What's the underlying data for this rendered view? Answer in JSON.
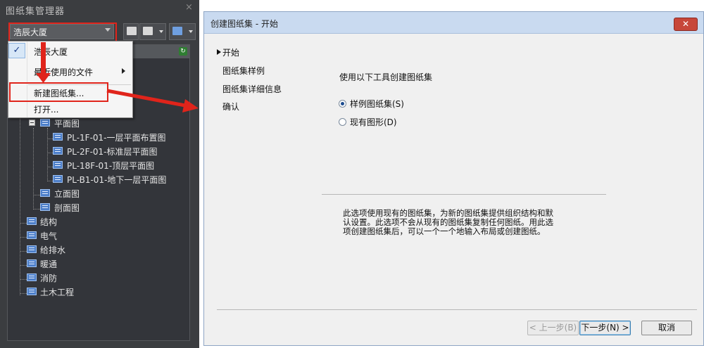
{
  "palette": {
    "title": "图纸集管理器",
    "close_glyph": "×",
    "combo_value": "浩辰大厦",
    "context_menu": {
      "items": [
        {
          "label": "浩辰大厦",
          "checked": true
        },
        {
          "label": "最近使用的文件",
          "submenu": true
        },
        {
          "label": "新建图纸集..."
        },
        {
          "label": "打开..."
        }
      ],
      "check_glyph": "✓"
    },
    "tree": {
      "plan": "平面图",
      "plan_sheets": [
        "PL-1F-01-一层平面布置图",
        "PL-2F-01-标准层平面图",
        "PL-18F-01-顶层平面图",
        "PL-B1-01-地下一层平面图"
      ],
      "elevation": "立面图",
      "section": "剖面图",
      "disciplines": [
        "结构",
        "电气",
        "给排水",
        "暖通",
        "消防",
        "土木工程"
      ]
    }
  },
  "dialog": {
    "title": "创建图纸集 - 开始",
    "close_glyph": "✕",
    "nav": [
      "开始",
      "图纸集样例",
      "图纸集详细信息",
      "确认"
    ],
    "heading": "使用以下工具创建图纸集",
    "options": [
      {
        "label": "样例图纸集(S)",
        "selected": true
      },
      {
        "label": "现有图形(D)",
        "selected": false
      }
    ],
    "description": [
      "此选项使用现有的图纸集，为新的图纸集提供组织结构和默",
      "认设置。此选项不会从现有的图纸集复制任何图纸。用此选",
      "项创建图纸集后，可以一个一个地输入布局或创建图纸。"
    ],
    "buttons": {
      "back": "< 上一步(B)",
      "next": "下一步(N) >",
      "cancel": "取消"
    }
  },
  "colors": {
    "highlight_red": "#e0241b",
    "palette_bg": "#3b3d40",
    "dialog_title_bg": "#c9daf0"
  }
}
